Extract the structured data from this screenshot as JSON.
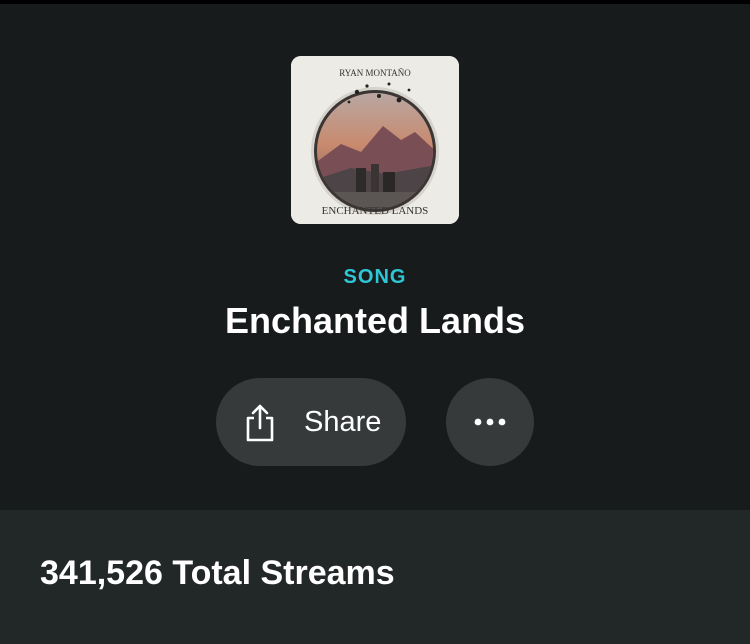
{
  "header": {
    "cover": {
      "artist_text": "RYAN MONTAÑO",
      "album_text": "ENCHANTED LANDS",
      "icon": "album-cover-image"
    },
    "type_label": "SONG",
    "title": "Enchanted Lands"
  },
  "actions": {
    "share": {
      "label": "Share",
      "icon": "share-icon"
    },
    "more": {
      "icon": "more-options-icon"
    }
  },
  "stats": {
    "total_streams": "341,526 Total Streams"
  },
  "colors": {
    "background": "#181b1c",
    "panel": "#222728",
    "button": "#363a3b",
    "accent": "#2fc6d6",
    "text": "#ffffff"
  }
}
